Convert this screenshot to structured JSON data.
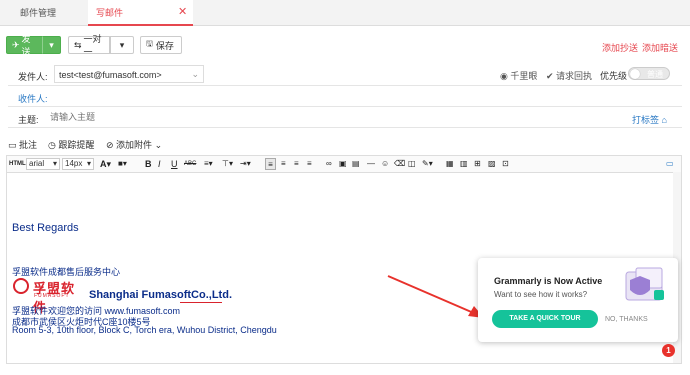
{
  "tabs": [
    {
      "label": "邮件管理"
    },
    {
      "label": "写邮件"
    }
  ],
  "toolbar": {
    "send": "发送",
    "one_to_one": "一对一",
    "save": "保存",
    "add_cc": "添加抄送",
    "add_bcc": "添加暗送"
  },
  "fields": {
    "from_label": "发件人:",
    "from_value": "test<test@fumasoft.com>",
    "to_label": "收件人:",
    "subject_label": "主题:",
    "subject_placeholder": "请输入主题",
    "tracking": "千里眼",
    "read_receipt": "请求回执",
    "priority": "优先级",
    "priority_value": "普通",
    "tag": "打标签"
  },
  "attach_bar": {
    "annotate": "批注",
    "follow_up": "跟踪提醒",
    "add_attachment": "添加附件"
  },
  "format_bar": {
    "html": "HTML",
    "font": "arial",
    "size": "14px"
  },
  "body": {
    "regards": "Best Regards",
    "line1": "孚盟软件成都售后服务中心",
    "logo_cn": "孚盟软件",
    "logo_en": "FUMASOFT",
    "company": "Shanghai FumasoftCo.,Ltd.",
    "line2": "孚盟软件欢迎您的访问 www.fumasoft.com",
    "line3": "成都市武侯区火炬时代C座10楼5号",
    "line4": "Room 5-3, 10th floor, Block C, Torch era, Wuhou District, Chengdu"
  },
  "grammarly": {
    "title": "Grammarly is Now Active",
    "subtitle": "Want to see how it works?",
    "tour": "TAKE A QUICK TOUR",
    "no": "NO, THANKS",
    "badge": "1"
  }
}
